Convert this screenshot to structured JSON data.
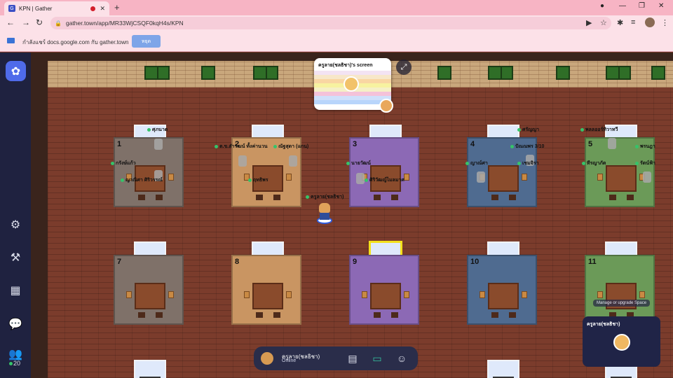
{
  "browser": {
    "tab_title": "KPN | Gather",
    "url": "gather.town/app/MR33WjCSQF0kqH4s/KPN",
    "new_tab": "+",
    "minimize": "—",
    "maximize": "❐",
    "close": "✕"
  },
  "sharebar": {
    "text": "กำลังแชร์ docs.google.com กับ gather.town",
    "stop_label": "หยุด"
  },
  "sidebar": {
    "online_count": "20"
  },
  "map": {
    "rooms": [
      {
        "num": "1",
        "color": "#7f7169"
      },
      {
        "num": "2",
        "color": "#c99562"
      },
      {
        "num": "3",
        "color": "#8c69b5"
      },
      {
        "num": "4",
        "color": "#4f6b90"
      },
      {
        "num": "5",
        "color": "#6b9a58"
      },
      {
        "num": "7",
        "color": "#7f7169"
      },
      {
        "num": "8",
        "color": "#c99562"
      },
      {
        "num": "9",
        "color": "#8c69b5"
      },
      {
        "num": "10",
        "color": "#4f6b90"
      },
      {
        "num": "11",
        "color": "#6b9a58"
      }
    ],
    "nametags": [
      {
        "text": "ศุภนาต"
      },
      {
        "text": "ต.ข.สำวัฒน์ ทั้งค่านวน"
      },
      {
        "text": "ณัฐสุดา (แกน)"
      },
      {
        "text": "ศรัญญา"
      },
      {
        "text": "พลลออร์ทิวาทวี"
      },
      {
        "text": "กรังษ์แก้ว"
      },
      {
        "text": "นายวัฒน์"
      },
      {
        "text": "ปัณณพร 3/10"
      },
      {
        "text": "พรนฎา"
      },
      {
        "text": "ญาณ์ศา"
      },
      {
        "text": "เชมจิรา"
      },
      {
        "text": "ทีรญาภัต"
      },
      {
        "text": "รัตน์ฟ้า"
      },
      {
        "text": "ญาณิศา ศิริวรรณ์"
      },
      {
        "text": "ฤทธิพร"
      },
      {
        "text": "ศิริวัฒญ์ไมลมาศ"
      },
      {
        "text": "ครูลาย(ชลธิชา)"
      }
    ],
    "screenshare_label": "ครูลาย(ชลธิชา)'s screen"
  },
  "bottombar": {
    "user_name": "ครูลาย(ชลธิชา)",
    "user_status": "Online"
  },
  "tooltip": "Manage or upgrade Space",
  "videotile": {
    "name": "ครูลาย(ชลธิชา)"
  }
}
